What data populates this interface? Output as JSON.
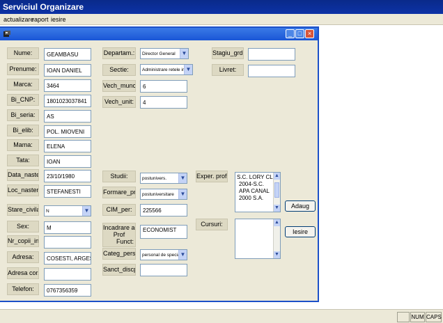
{
  "app": {
    "title": "Serviciul Organizare"
  },
  "menu": {
    "items": [
      "actualizare",
      "raport",
      "iesire"
    ]
  },
  "form": {
    "left": {
      "nume": {
        "label": "Nume:",
        "value": "GEAMBASU"
      },
      "prenume": {
        "label": "Prenume:",
        "value": "IOAN DANIEL"
      },
      "marca": {
        "label": "Marca:",
        "value": "3464"
      },
      "bi_cnp": {
        "label": "Bi_CNP:",
        "value": "1801023037841"
      },
      "bi_seria": {
        "label": "Bi_seria:",
        "value": "AS"
      },
      "bi_elib": {
        "label": "Bi_elib:",
        "value": "POL. MIOVENI"
      },
      "mama": {
        "label": "Mama:",
        "value": "ELENA"
      },
      "tata": {
        "label": "Tata:",
        "value": "IOAN"
      },
      "data_nastere": {
        "label": "Data_nastere",
        "value": "23/10/1980"
      },
      "loc_nastere": {
        "label": "Loc_nastere:",
        "value": "STEFANESTI"
      },
      "stare_civila": {
        "label": "Stare_civila:",
        "value": "N"
      },
      "sex": {
        "label": "Sex:",
        "value": "M"
      },
      "nr_copii": {
        "label": "Nr_copii_intr:",
        "value": ""
      },
      "adresa": {
        "label": "Adresa:",
        "value": "COSESTI, ARGES"
      },
      "adresa_cor": {
        "label": "Adresa cor.:",
        "value": ""
      },
      "telefon": {
        "label": "Telefon:",
        "value": "0767356359"
      }
    },
    "middle": {
      "departam": {
        "label": "Departam.:",
        "value": "Director General"
      },
      "sectie": {
        "label": "Sectie:",
        "value": "Administrare retele info"
      },
      "vech_munc": {
        "label": "Vech_munc:",
        "value": "6"
      },
      "vech_unit": {
        "label": "Vech_unit:",
        "value": "4"
      },
      "studii": {
        "label": "Studii:",
        "value": "postunivers."
      },
      "formare_prof": {
        "label": "Formare_prof",
        "value": "postuniversitare"
      },
      "cim_per": {
        "label": "CIM_per:",
        "value": "225566"
      },
      "incadrare": {
        "label_line1": "Incadrare act.",
        "label_line2": "Prof",
        "label_line3": "Funct:",
        "value": "ECONOMIST"
      },
      "categ_pers": {
        "label": "Categ_pers:",
        "value": "personal de specialit"
      },
      "sanct_discp": {
        "label": "Sanct_discp:",
        "value": ""
      }
    },
    "right": {
      "stagiu_grd": {
        "label": "Stagiu_grd:",
        "value": ""
      },
      "livret": {
        "label": "Livret:",
        "value": ""
      },
      "exper_prof": {
        "label": "Exper. prof:",
        "lines": [
          "S.C. LORY CL",
          "2004-S.C.",
          "APA CANAL",
          "2000 S.A."
        ]
      },
      "cursuri": {
        "label": "Cursuri:",
        "value": ""
      }
    },
    "buttons": {
      "adaug": "Adaug",
      "iesire": "Iesire"
    }
  },
  "statusbar": {
    "num": "NUM",
    "caps": "CAPS"
  }
}
